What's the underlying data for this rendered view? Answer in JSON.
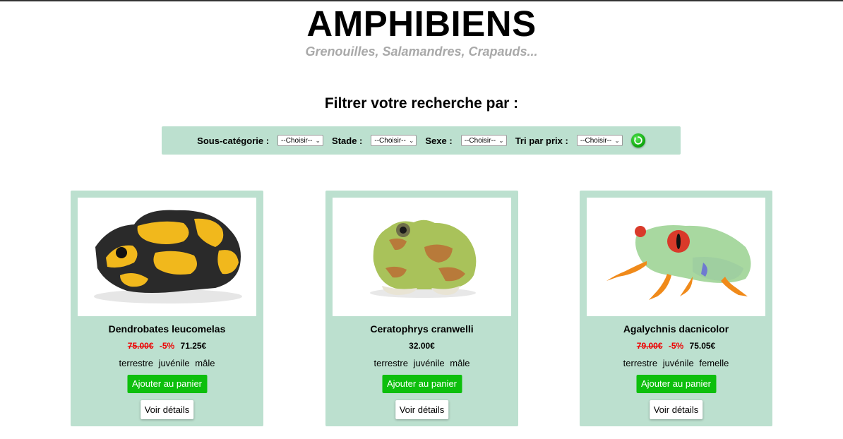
{
  "header": {
    "title": "AMPHIBIENS",
    "subtitle": "Grenouilles, Salamandres, Crapauds..."
  },
  "filters": {
    "heading": "Filtrer votre recherche par :",
    "subcategory": {
      "label": "Sous-catégorie :",
      "value": "--Choisir--"
    },
    "stage": {
      "label": "Stade :",
      "value": "--Choisir--"
    },
    "sex": {
      "label": "Sexe :",
      "value": "--Choisir--"
    },
    "price_sort": {
      "label": "Tri par prix :",
      "value": "--Choisir--"
    },
    "reset_icon": "refresh-icon"
  },
  "products": [
    {
      "name": "Dendrobates leucomelas",
      "old_price": "75.00€",
      "discount": "-5%",
      "price": "71.25€",
      "tags": [
        "terrestre",
        "juvénile",
        "mâle"
      ],
      "cart_label": "Ajouter au panier",
      "details_label": "Voir détails"
    },
    {
      "name": "Ceratophrys cranwelli",
      "old_price": "",
      "discount": "",
      "price": "32.00€",
      "tags": [
        "terrestre",
        "juvénile",
        "mâle"
      ],
      "cart_label": "Ajouter au panier",
      "details_label": "Voir détails"
    },
    {
      "name": "Agalychnis dacnicolor",
      "old_price": "79.00€",
      "discount": "-5%",
      "price": "75.05€",
      "tags": [
        "terrestre",
        "juvénile",
        "femelle"
      ],
      "cart_label": "Ajouter au panier",
      "details_label": "Voir détails"
    }
  ],
  "colors": {
    "panel": "#bce0cf",
    "accent_green": "#0dbf0d",
    "discount_red": "#ee0000",
    "subtitle_gray": "#a9a9a9"
  }
}
